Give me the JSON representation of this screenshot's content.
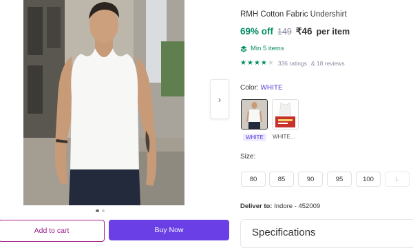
{
  "product": {
    "title": "RMH Cotton Fabric Undershirt",
    "discount": "69% off",
    "mrp": "149",
    "price": "₹46",
    "price_suffix": "per item",
    "min_items": "Min 5 items",
    "rating_stars": 4,
    "rating_max": 5,
    "ratings_text": "336 ratings",
    "reviews_text": "& 18 reviews"
  },
  "gallery": {
    "image_count": 2,
    "active_index": 0,
    "next_icon": "chevron-right-icon"
  },
  "color": {
    "label": "Color:",
    "selected_value": "WHITE",
    "options": [
      {
        "label": "WHITE",
        "selected": true
      },
      {
        "label": "WHITE...",
        "selected": false
      }
    ]
  },
  "size": {
    "label": "Size:",
    "options": [
      {
        "label": "80",
        "available": true
      },
      {
        "label": "85",
        "available": true
      },
      {
        "label": "90",
        "available": true
      },
      {
        "label": "95",
        "available": true
      },
      {
        "label": "100",
        "available": true
      },
      {
        "label": "L",
        "available": false
      }
    ]
  },
  "delivery": {
    "label": "Deliver to:",
    "location": "Indore - 452009"
  },
  "actions": {
    "add_to_cart": "Add to cart",
    "buy_now": "Buy Now"
  },
  "specifications": {
    "title": "Specifications"
  },
  "colors": {
    "brand_purple": "#9f2089",
    "buy_button": "#6a3fe5",
    "discount_green": "#038d63",
    "accent_violet": "#5c3bd6"
  }
}
